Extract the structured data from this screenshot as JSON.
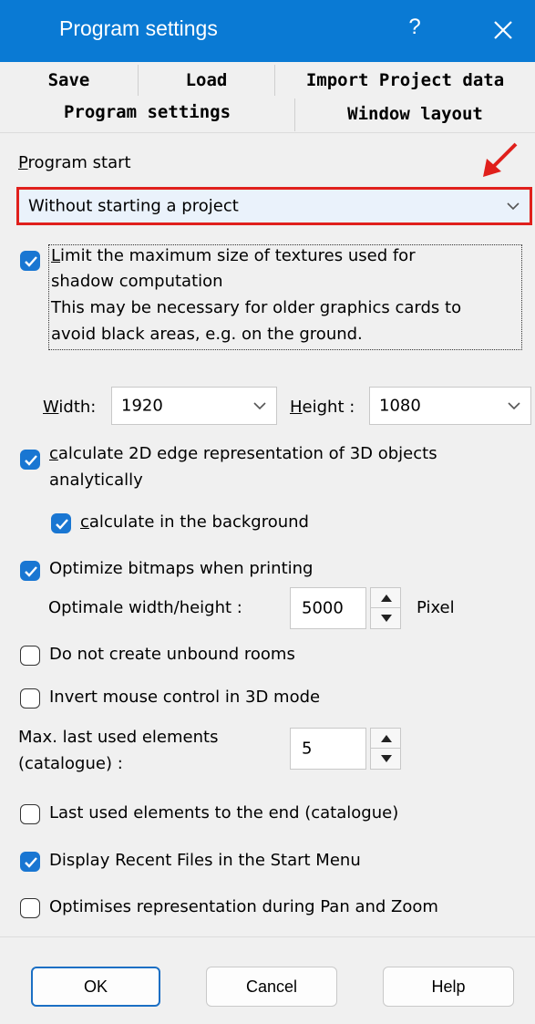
{
  "window": {
    "title": "Program settings",
    "help": "?"
  },
  "tabs": {
    "save": "Save",
    "load": "Load",
    "import": "Import Project data",
    "program_settings": "Program settings",
    "window_layout": "Window layout"
  },
  "program_start": {
    "label_first": "P",
    "label_rest": "rogram start",
    "selected": "Without starting a project"
  },
  "limit_textures": {
    "checked": true,
    "first_char": "L",
    "line1_rest": "imit the maximum size of textures used for",
    "line2": "shadow computation",
    "line3": "This may be necessary for older graphics cards to",
    "line4": "avoid black areas, e.g. on the ground."
  },
  "width": {
    "label_first": "W",
    "label_rest": "idth:",
    "value": "1920"
  },
  "height": {
    "label_first": "H",
    "label_rest": "eight :",
    "value": "1080"
  },
  "calc_2d": {
    "checked": true,
    "first_char": "c",
    "line1_rest": "alculate 2D edge representation of 3D objects",
    "line2": "analytically"
  },
  "calc_background": {
    "checked": true,
    "first_char": "c",
    "label_rest": "alculate in the background"
  },
  "optimize_bitmaps": {
    "checked": true,
    "label": "Optimize bitmaps when printing",
    "size_label": "Optimale width/height :",
    "size_value": "5000",
    "unit": "Pixel"
  },
  "unbound_rooms": {
    "checked": false,
    "label": "Do not create unbound rooms"
  },
  "invert_mouse": {
    "checked": false,
    "label": "Invert mouse control in 3D mode"
  },
  "max_last_used": {
    "line1": "Max. last used elements",
    "line2": "(catalogue) :",
    "value": "5"
  },
  "last_used_end": {
    "checked": false,
    "label": "Last used elements to the end (catalogue)"
  },
  "recent_files": {
    "checked": true,
    "label": "Display Recent Files in the Start Menu"
  },
  "optimise_pan": {
    "checked": false,
    "label": "Optimises representation during Pan and Zoom"
  },
  "buttons": {
    "ok": "OK",
    "cancel": "Cancel",
    "help": "Help"
  },
  "colors": {
    "titlebar": "#0a7ad4",
    "checkbox_on": "#1976d2",
    "annotation_red": "#e0201c",
    "dialog_bg": "#f0f0f0"
  },
  "icons": {
    "close": "close-icon",
    "dropdown": "chevron-down-icon",
    "annotation": "red-arrow-icon"
  }
}
